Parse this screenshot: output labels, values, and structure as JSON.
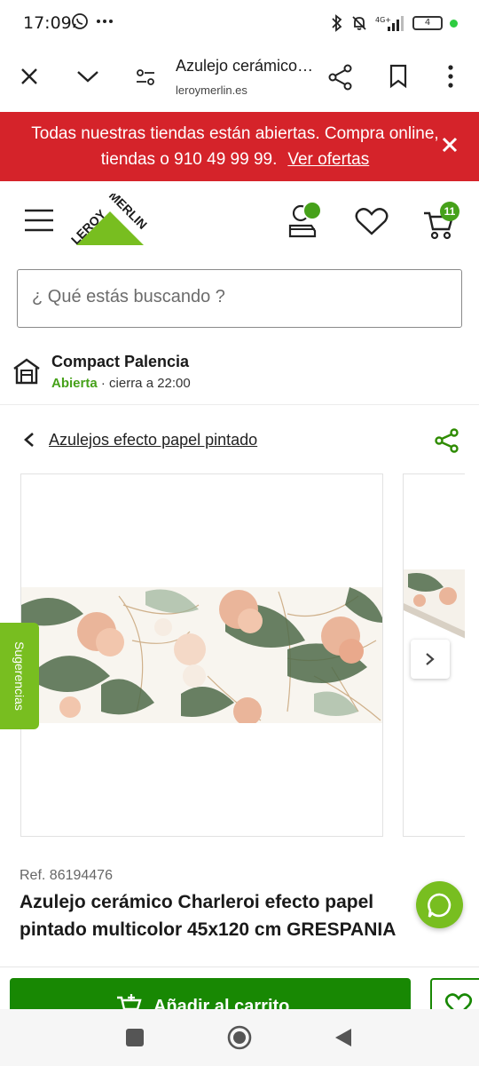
{
  "status_bar": {
    "time": "17:09",
    "battery": "4",
    "network": "4G+"
  },
  "browser": {
    "page_title": "Azulejo cerámico…",
    "domain": "leroymerlin.es"
  },
  "promo": {
    "text": "Todas nuestras tiendas están abiertas. Compra online, tiendas o 910 49 99 99.",
    "link": "Ver ofertas"
  },
  "header": {
    "logo_top": "LEROY",
    "logo_bottom": "MERLIN",
    "cart_count": "11"
  },
  "search": {
    "placeholder": "¿ Qué estás buscando ?"
  },
  "store": {
    "name": "Compact Palencia",
    "status": "Abierta",
    "hours": " · cierra a 22:00"
  },
  "breadcrumb": {
    "label": "Azulejos efecto papel pintado"
  },
  "sidebar_tab": {
    "label": "Sugerencias"
  },
  "product": {
    "ref": "Ref. 86194476",
    "title_line1": "Azulejo cerámico Charleroi efecto papel",
    "title_line2": "pintado multicolor 45x120 cm GRESPANIA",
    "add_to_cart": "Añadir al carrito"
  },
  "colors": {
    "brand_green": "#78be20",
    "cta_green": "#188803",
    "promo_red": "#d5232a"
  }
}
